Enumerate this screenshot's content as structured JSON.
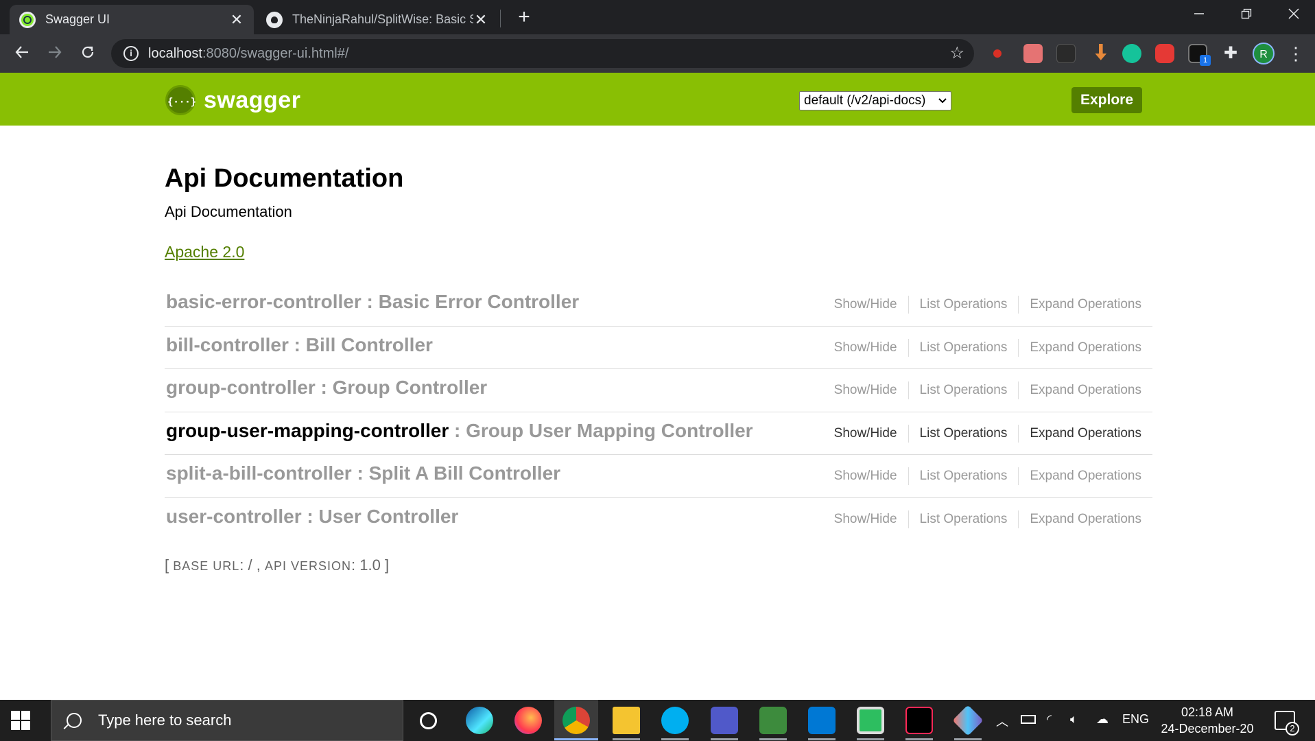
{
  "browser": {
    "tabs": [
      {
        "title": "Swagger UI",
        "active": true
      },
      {
        "title": "TheNinjaRahul/SplitWise: Basic Sp",
        "active": false
      }
    ],
    "address": {
      "host": "localhost",
      "rest": ":8080/swagger-ui.html#/"
    },
    "profile_initial": "R",
    "extension_badge": "1",
    "new_tab_glyph": "+",
    "close_glyph": "✕"
  },
  "swagger": {
    "logo_text": "swagger",
    "logo_mark": "{···}",
    "spec_selector": "default (/v2/api-docs)",
    "explore_label": "Explore",
    "brand_color": "#89bf04"
  },
  "api": {
    "title": "Api Documentation",
    "description": "Api Documentation",
    "license": "Apache 2.0"
  },
  "resources": [
    {
      "name": "basic-error-controller",
      "desc": "Basic Error Controller",
      "highlighted": false
    },
    {
      "name": "bill-controller",
      "desc": "Bill Controller",
      "highlighted": false
    },
    {
      "name": "group-controller",
      "desc": "Group Controller",
      "highlighted": false
    },
    {
      "name": "group-user-mapping-controller",
      "desc": "Group User Mapping Controller",
      "highlighted": true
    },
    {
      "name": "split-a-bill-controller",
      "desc": "Split A Bill Controller",
      "highlighted": false
    },
    {
      "name": "user-controller",
      "desc": "User Controller",
      "highlighted": false
    }
  ],
  "operations": {
    "show_hide": "Show/Hide",
    "list": "List Operations",
    "expand": "Expand Operations"
  },
  "base_info": {
    "open": "[",
    "base_url_label": "BASE URL",
    "base_url": "/",
    "api_version_label": "API VERSION",
    "api_version": "1.0",
    "close": "]"
  },
  "taskbar": {
    "search_placeholder": "Type here to search",
    "language": "ENG",
    "time": "02:18 AM",
    "date": "24-December-20",
    "notification_count": "2"
  }
}
